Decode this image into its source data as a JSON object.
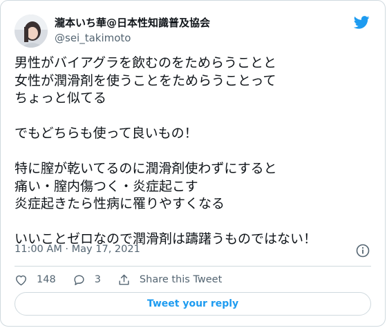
{
  "author": {
    "name": "瀧本いち華@日本性知識普及協会",
    "handle": "@sei_takimoto",
    "avatar_icon": "user-avatar-photo"
  },
  "logo_icon": "twitter-bird-icon",
  "brand_color": "#1d9bf0",
  "tweet": {
    "lines": [
      "男性がバイアグラを飲むのをためらうことと",
      "女性が潤滑剤を使うことをためらうことって",
      "ちょっと似てる",
      "",
      "でもどちらも使って良いもの！",
      "",
      "特に膣が乾いてるのに潤滑剤使わずにすると",
      "痛い・膣内傷つく・炎症起こす",
      "炎症起きたら性病に罹りやすくなる",
      "",
      "いいことゼロなので潤滑剤は躊躇うものではない！"
    ]
  },
  "timestamp": "11:00 AM · May 17, 2021",
  "actions": {
    "like_count": "148",
    "reply_count": "3",
    "share_label": "Share this Tweet"
  },
  "reply_button_label": "Tweet your reply"
}
